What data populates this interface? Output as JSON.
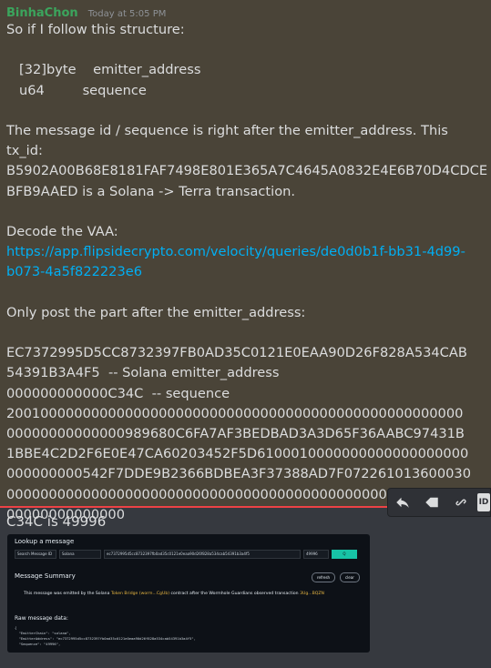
{
  "message1": {
    "author": "BinhaChon",
    "timestamp": "Today at 5:05 PM",
    "lines": {
      "l1": "So if I follow this structure:",
      "l2": "[32]byte    emitter_address",
      "l3": "u64         sequence",
      "l4": "The message id / sequence is right after the emitter_address. This tx_id: B5902A00B68E8181FAF7498E801E365A7C4645A0832E4E6B70D4CDCE BFB9AAED is a Solana -> Terra transaction.",
      "l5": "Decode the VAA:",
      "link": "https://app.flipsidecrypto.com/velocity/queries/de0d0b1f-bb31-4d99-b073-4a5f822223e6",
      "l6": "Only post the part after the emitter_address:",
      "l7": "EC7372995D5CC8732397FB0AD35C0121E0EAA90D26F828A534CAB54391B3A4F5  -- Solana emitter_address",
      "l8": "000000000000C34C  -- sequence",
      "l9": "20010000000000000000000000000000000000000000000000000000000000000000989680C6FA7AF3BEDBAD3A3D65F36AABC97431B1BBE4C2D2F6E0E47CA60203452F5D6100010000000000000000000000000000542F7DDE9B2366BDBEA3F37388AD7F07226101360003000000000000000000000000000000000000000000000000000000000000000000000"
    }
  },
  "toolbar": {
    "icons": [
      "reply-icon",
      "tag-icon",
      "link-icon",
      "more-icon"
    ],
    "more_label": "ID"
  },
  "message2": {
    "text": "C34C is 49996"
  },
  "embedded_screenshot": {
    "title": "Lookup a message",
    "search_placeholder": "Search Message ID",
    "chain": "Solana",
    "emitter_input": "ec7372995d5cc8732397fb0ad35c0121e0eaa90d26f828a534cab54391b3a4f5",
    "sequence_input": "49996",
    "go_label": "Q",
    "summary_title": "Message Summary",
    "refresh_label": "refresh",
    "clear_label": "clear",
    "summary_text_a": "This message was emitted by the Solana ",
    "summary_token": "Token Bridge (worm...CgUb)",
    "summary_text_b": " contract after the Wormhole Guardians observed transaction ",
    "summary_tx": "3Ug...BQZN",
    "raw_title": "Raw message data:",
    "raw_code": "{\n  \"EmitterChain\": \"solana\",\n  \"EmitterAddress\": \"ec7372995d5cc8732397fb0ad35c0121e0eaa90d26f828a534cab54391b3a4f5\",\n  \"Sequence\": \"49996\","
  }
}
